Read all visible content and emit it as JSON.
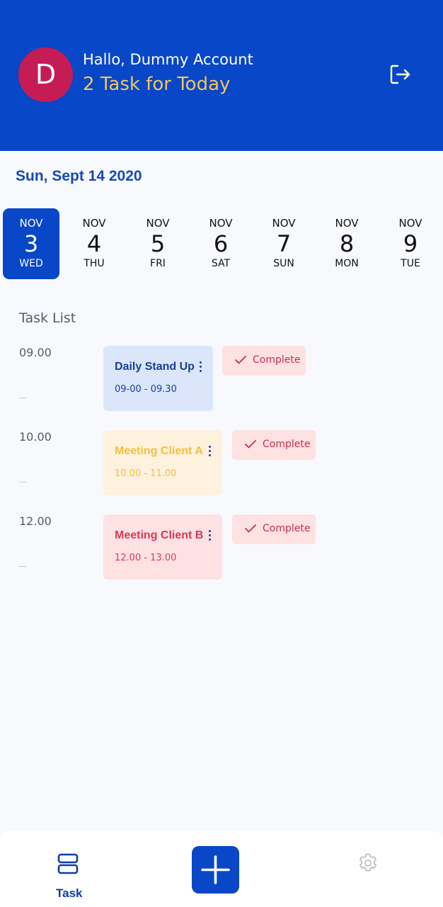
{
  "header": {
    "avatar_letter": "D",
    "greeting": "Hallo, Dummy Account",
    "task_summary": "2 Task for Today",
    "logout_icon": "logout-icon"
  },
  "current_date": "Sun, Sept 14 2020",
  "days": [
    {
      "month": "NOV",
      "day": "3",
      "weekday": "WED",
      "active": true
    },
    {
      "month": "NOV",
      "day": "4",
      "weekday": "THU"
    },
    {
      "month": "NOV",
      "day": "5",
      "weekday": "FRI"
    },
    {
      "month": "NOV",
      "day": "6",
      "weekday": "SAT"
    },
    {
      "month": "NOV",
      "day": "7",
      "weekday": "SUN"
    },
    {
      "month": "NOV",
      "day": "8",
      "weekday": "MON"
    },
    {
      "month": "NOV",
      "day": "9",
      "weekday": "TUE"
    }
  ],
  "task_list_title": "Task List",
  "tasks": [
    {
      "time": "09.00",
      "title": "Daily Stand Up",
      "range": "09-00 - 09.30",
      "action": "Complete"
    },
    {
      "time": "10.00",
      "title": "Meeting Client A",
      "range": "10.00 - 11.00",
      "action": "Complete"
    },
    {
      "time": "12.00",
      "title": "Meeting Client B",
      "range": "12.00 - 13.00",
      "action": "Complete"
    }
  ],
  "colors": {
    "primary": "#0847c7",
    "accent_yellow": "#f2c55a",
    "avatar": "#c51c55",
    "card_blue_bg": "#dbe6fb",
    "card_yellow_bg": "#fef1de",
    "card_red_bg": "#fde1e3",
    "complete_red": "#c3304c"
  },
  "bottom_nav": {
    "task_label": "Task",
    "task_icon": "task-list-icon",
    "add_icon": "plus-icon",
    "settings_icon": "gear-icon"
  }
}
